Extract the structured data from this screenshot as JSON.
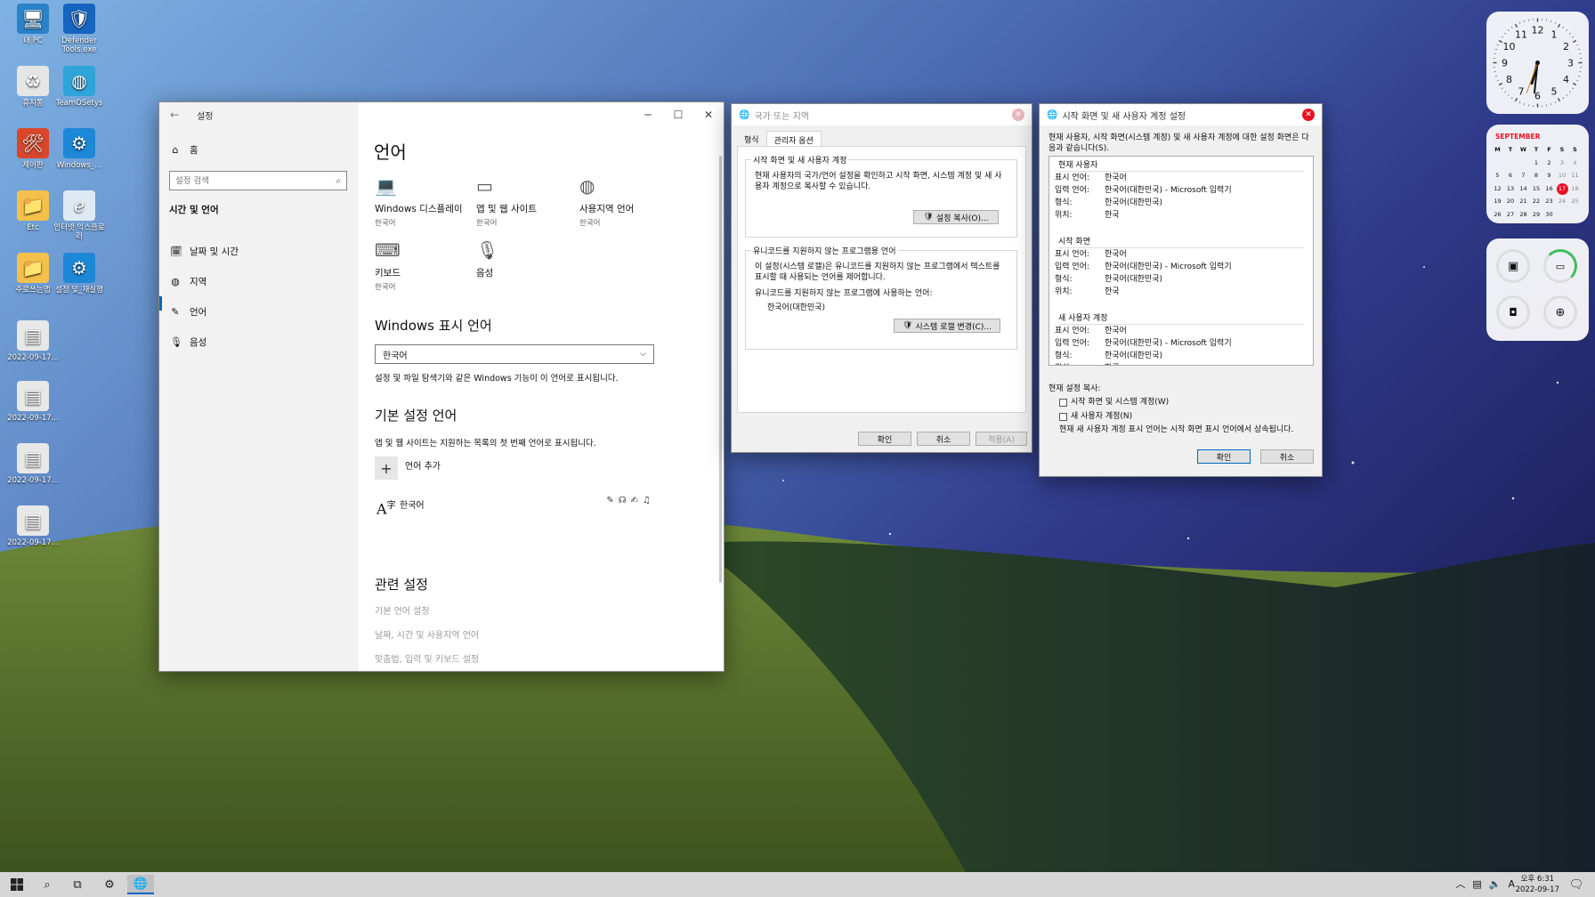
{
  "desktop": {
    "icons": [
      {
        "label": "내 PC",
        "icon": "monitor-icon"
      },
      {
        "label": "Defender Tools.exe",
        "icon": "shield-icon"
      },
      {
        "label": "휴지통",
        "icon": "recycle-bin-icon"
      },
      {
        "label": "TeamOSetys",
        "icon": "globe-icon"
      },
      {
        "label": "제어판",
        "icon": "control-panel-icon"
      },
      {
        "label": "Windows_...",
        "icon": "gear-icon"
      },
      {
        "label": "Etc",
        "icon": "folder-icon"
      },
      {
        "label": "인터넷 익스플로러",
        "icon": "ie-icon"
      },
      {
        "label": "주로쓰는앱",
        "icon": "folder-icon"
      },
      {
        "label": "설정 및_재실행",
        "icon": "gear-icon"
      },
      {
        "label": "2022-09-17...",
        "icon": "screenshot-icon"
      },
      {
        "label": "2022-09-17...",
        "icon": "screenshot-icon"
      },
      {
        "label": "2022-09-17...",
        "icon": "screenshot-icon"
      },
      {
        "label": "2022-09-17...",
        "icon": "screenshot-icon"
      }
    ]
  },
  "settings": {
    "title": "설정",
    "home": "홈",
    "search_placeholder": "설정 검색",
    "category": "시간 및 언어",
    "nav": [
      {
        "label": "날짜 및 시간",
        "icon": "calendar-icon"
      },
      {
        "label": "지역",
        "icon": "region-icon"
      },
      {
        "label": "언어",
        "icon": "language-icon"
      },
      {
        "label": "음성",
        "icon": "microphone-icon"
      }
    ],
    "page_title": "언어",
    "tiles": [
      {
        "label": "Windows 디스플레이",
        "sub": "한국어",
        "icon": "laptop-icon"
      },
      {
        "label": "앱 및 웹 사이트",
        "sub": "한국어",
        "icon": "window-icon"
      },
      {
        "label": "사용지역 언어",
        "sub": "한국어",
        "icon": "globe-icon"
      },
      {
        "label": "키보드",
        "sub": "한국어",
        "icon": "keyboard-icon"
      },
      {
        "label": "음성",
        "sub": "",
        "icon": "microphone-icon"
      }
    ],
    "display_lang_heading": "Windows 표시 언어",
    "display_lang_value": "한국어",
    "display_lang_desc": "설정 및 파일 탐색기와 같은 Windows 기능이 이 언어로 표시됩니다.",
    "pref_heading": "기본 설정 언어",
    "pref_desc": "앱 및 웹 사이트는 지원하는 목록의 첫 번째 언어로 표시됩니다.",
    "add_lang": "언어 추가",
    "lang_item": "한국어",
    "related_heading": "관련 설정",
    "related_links": [
      "기본 언어 설정",
      "날짜, 시간 및 사용지역 언어",
      "맞춤법, 입력 및 키보드 설정"
    ]
  },
  "region_dialog": {
    "title": "국가 또는 지역",
    "tabs": [
      "형식",
      "관리자 옵션"
    ],
    "group1_title": "시작 화면 및 새 사용자 계정",
    "group1_text": "현재 사용자의 국가/언어 설정을 확인하고 시작 화면, 시스템 계정 및 새 사용자 계정으로 복사할 수 있습니다.",
    "copy_btn": "설정 복사(O)...",
    "group2_title": "유니코드를 지원하지 않는 프로그램용 언어",
    "group2_text": "이 설정(시스템 로캘)은 유니코드를 지원하지 않는 프로그램에서 텍스트를 표시할 때 사용되는 언어를 제어합니다.",
    "group2_label": "유니코드를 지원하지 않는 프로그램에 사용하는 언어:",
    "group2_value": "한국어(대한민국)",
    "locale_btn": "시스템 로캘 변경(C)...",
    "ok": "확인",
    "cancel": "취소",
    "apply": "적용(A)"
  },
  "copy_dialog": {
    "title": "시작 화면 및 새 사용자 계정 설정",
    "intro": "현재 사용자, 시작 화면(시스템 계정) 및 새 사용자 계정에 대한 설정 화면은 다음과 같습니다(S).",
    "sections": [
      {
        "title": "현재 사용자",
        "rows": [
          {
            "k": "표시 언어:",
            "v": "한국어"
          },
          {
            "k": "입력 언어:",
            "v": "한국어(대한민국) - Microsoft 입력기"
          },
          {
            "k": "형식:",
            "v": "한국어(대한민국)"
          },
          {
            "k": "위치:",
            "v": "한국"
          }
        ]
      },
      {
        "title": "시작 화면",
        "rows": [
          {
            "k": "표시 언어:",
            "v": "한국어"
          },
          {
            "k": "입력 언어:",
            "v": "한국어(대한민국) - Microsoft 입력기"
          },
          {
            "k": "형식:",
            "v": "한국어(대한민국)"
          },
          {
            "k": "위치:",
            "v": "한국"
          }
        ]
      },
      {
        "title": "새 사용자 계정",
        "rows": [
          {
            "k": "표시 언어:",
            "v": "한국어"
          },
          {
            "k": "입력 언어:",
            "v": "한국어(대한민국) - Microsoft 입력기"
          },
          {
            "k": "형식:",
            "v": "한국어(대한민국)"
          },
          {
            "k": "위치:",
            "v": "한국"
          }
        ]
      }
    ],
    "copy_label": "현재 설정 복사:",
    "check1": "시작 화면 및 시스템 계정(W)",
    "check2": "새 사용자 계정(N)",
    "note": "현재 새 사용자 계정 표시 언어는 시작 화면 표시 언어에서 상속됩니다.",
    "ok": "확인",
    "cancel": "취소"
  },
  "calendar": {
    "month": "SEPTEMBER",
    "weekdays": [
      "M",
      "T",
      "W",
      "T",
      "F",
      "S",
      "S"
    ],
    "weeks": [
      [
        "",
        "",
        "",
        "1",
        "2",
        "3",
        "4"
      ],
      [
        "5",
        "6",
        "7",
        "8",
        "9",
        "10",
        "11"
      ],
      [
        "12",
        "13",
        "14",
        "15",
        "16",
        "17",
        "18"
      ],
      [
        "19",
        "20",
        "21",
        "22",
        "23",
        "24",
        "25"
      ],
      [
        "26",
        "27",
        "28",
        "29",
        "30",
        "",
        ""
      ]
    ],
    "today": "17"
  },
  "clock": {
    "numbers": [
      "12",
      "1",
      "2",
      "3",
      "4",
      "5",
      "6",
      "7",
      "8",
      "9",
      "10",
      "11"
    ]
  },
  "taskbar": {
    "time": "오후 6:31",
    "date": "2022-09-17",
    "ime": "A"
  },
  "colors": {
    "accent": "#0067c0",
    "today": "#e81123"
  }
}
